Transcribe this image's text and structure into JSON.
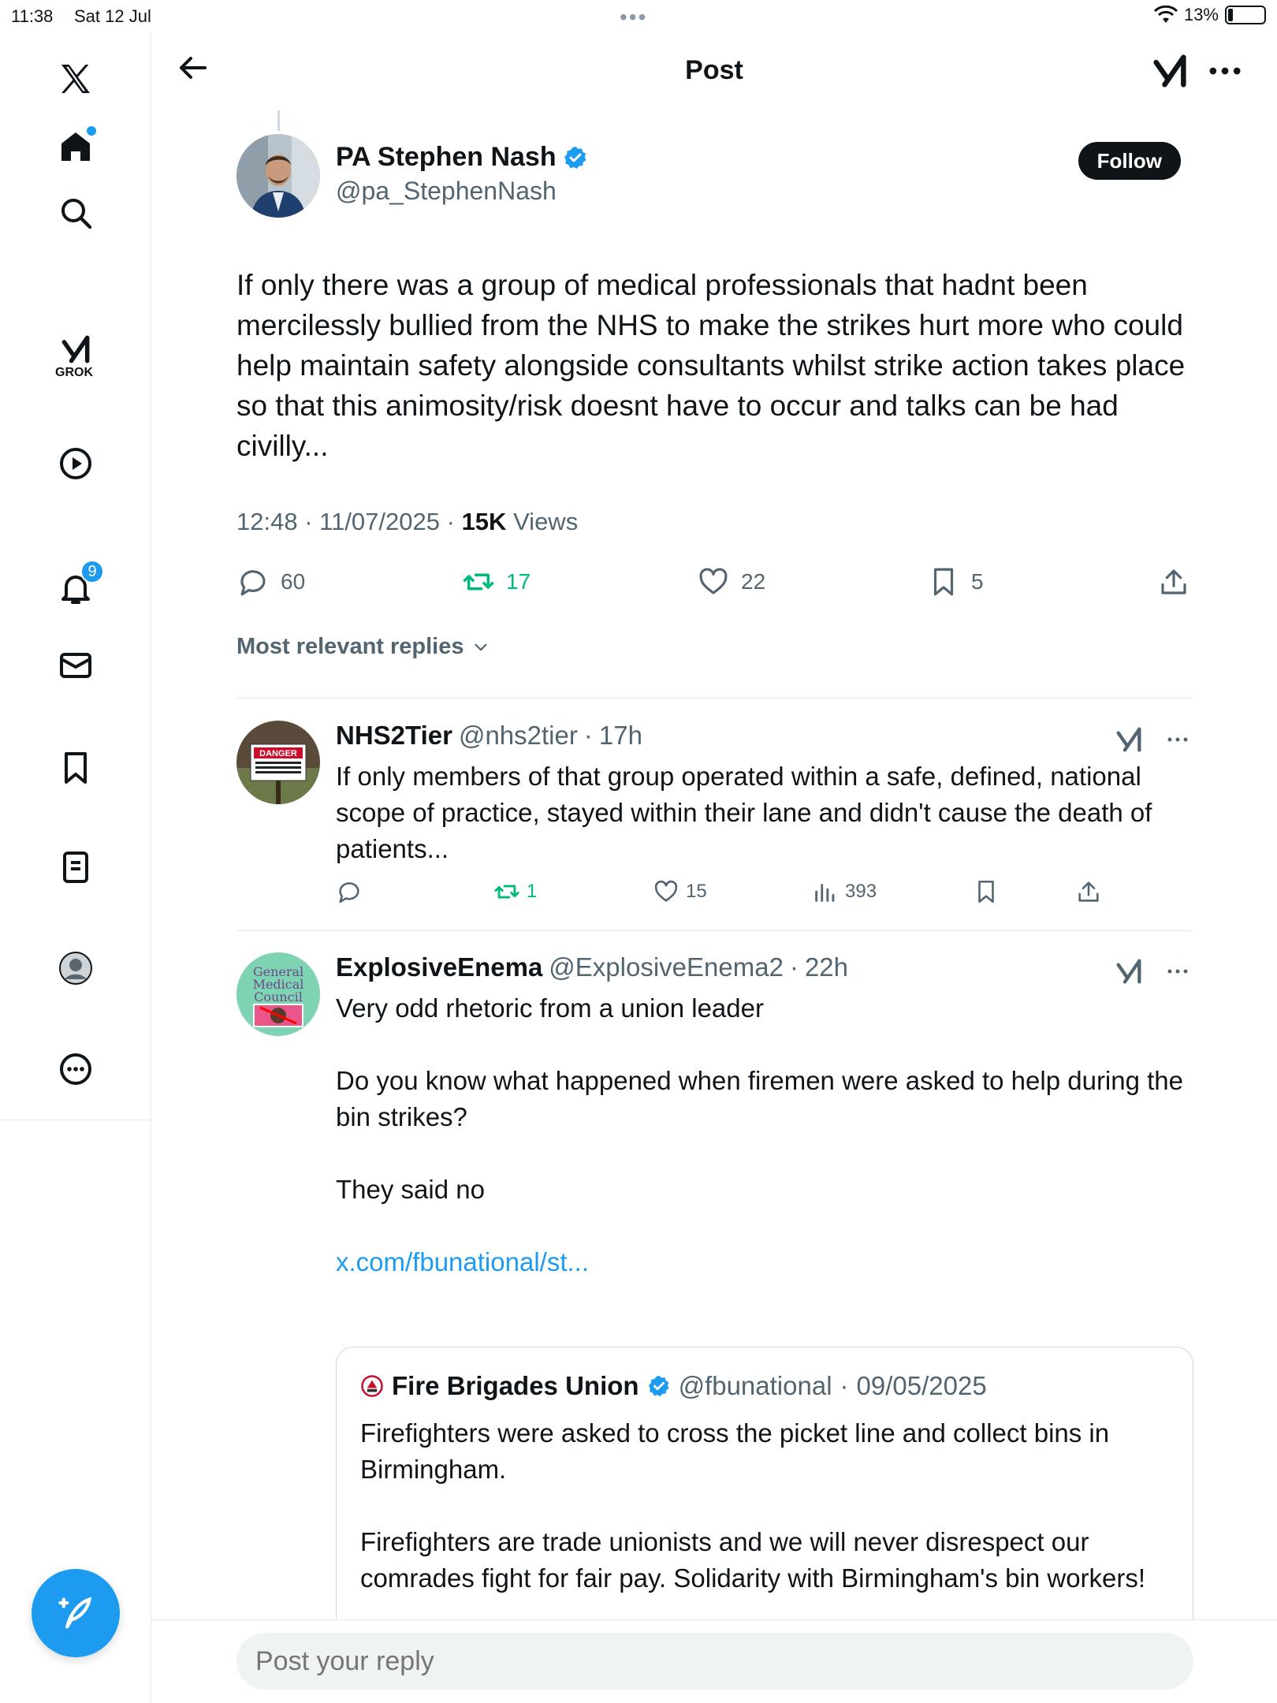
{
  "status_bar": {
    "time": "11:38",
    "date": "Sat 12 Jul",
    "battery": "13%"
  },
  "sidebar": {
    "grok_label": "GROK",
    "notifications_badge": "9"
  },
  "header": {
    "title": "Post"
  },
  "post": {
    "author_name": "PA Stephen Nash",
    "author_handle": "@pa_StephenNash",
    "follow_label": "Follow",
    "text": "If only there was a group of medical professionals that hadnt been mercilessly bullied from the NHS to make the strikes hurt more who could help maintain safety alongside consultants whilst strike action takes place so that this animosity/risk doesnt have to occur and talks can be had civilly...",
    "time": "12:48",
    "date": "11/07/2025",
    "views_count": "15K",
    "views_label": "Views",
    "replies": "60",
    "reposts": "17",
    "likes": "22",
    "bookmarks": "5"
  },
  "sort_label": "Most relevant replies",
  "replies": [
    {
      "name": "NHS2Tier",
      "handle": "@nhs2tier",
      "age": "17h",
      "text": "If only members of that group operated within a safe, defined, national scope of practice, stayed within their lane and didn't cause the death of patients...",
      "replies": "",
      "reposts": "1",
      "likes": "15",
      "views": "393"
    },
    {
      "name": "ExplosiveEnema",
      "handle": "@ExplosiveEnema2",
      "age": "22h",
      "line1": "Very odd rhetoric from a union leader",
      "line2": "Do you know what happened when firemen were asked to help during the bin strikes?",
      "line3": "They said no",
      "link": "x.com/fbunational/st...",
      "quote": {
        "name": "Fire Brigades Union",
        "handle": "@fbunational",
        "date": "09/05/2025",
        "para1": "Firefighters were asked to cross the picket line and collect bins in Birmingham.",
        "para2": "Firefighters are trade unionists and we will never disrespect our comrades fight for fair pay. Solidarity with Birmingham's bin workers!"
      }
    }
  ],
  "reply_bar": {
    "placeholder": "Post your reply"
  },
  "avatar_texts": {
    "danger": "DANGER",
    "gmc_1": "General",
    "gmc_2": "Medical",
    "gmc_3": "Council"
  },
  "colors": {
    "accent": "#1d9bf0",
    "repost_green": "#00ba7c",
    "muted": "#536471"
  }
}
